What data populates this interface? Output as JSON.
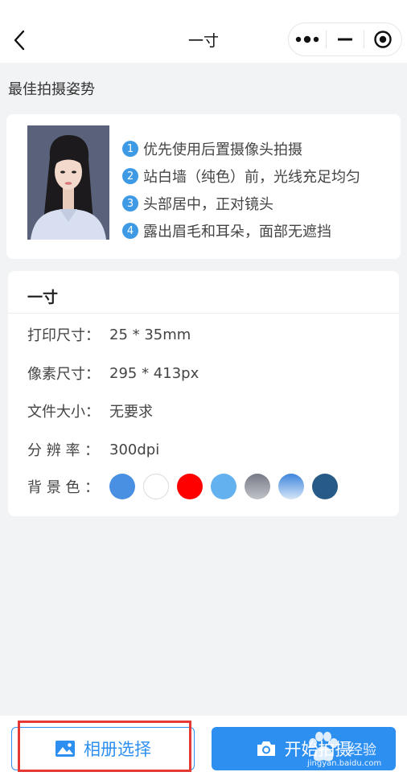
{
  "navbar": {
    "title": "一寸"
  },
  "pose_section": {
    "label": "最佳拍摄姿势",
    "tips": [
      {
        "num": "1",
        "text": "优先使用后置摄像头拍摄"
      },
      {
        "num": "2",
        "text": "站白墙（纯色）前，光线充足均匀"
      },
      {
        "num": "3",
        "text": "头部居中，正对镜头"
      },
      {
        "num": "4",
        "text": "露出眉毛和耳朵，面部无遮挡"
      }
    ]
  },
  "spec": {
    "title": "一寸",
    "rows": [
      {
        "key": "打印尺寸：",
        "value": "25 * 35mm"
      },
      {
        "key": "像素尺寸：",
        "value": "295 * 413px"
      },
      {
        "key": "文件大小：",
        "value": "无要求"
      },
      {
        "key": "分 辨 率 ：",
        "value": "300dpi"
      }
    ],
    "bg_label": "背 景 色 ：",
    "bg_colors": [
      {
        "name": "blue",
        "color": "#4a90e2"
      },
      {
        "name": "white",
        "color": "#ffffff"
      },
      {
        "name": "red",
        "color": "#ff0000"
      },
      {
        "name": "light-blue",
        "color": "#64b1f0"
      },
      {
        "name": "gray-gradient",
        "color": "#8b8d96"
      },
      {
        "name": "blue-gradient",
        "color": "#5b9ee6"
      },
      {
        "name": "dark-blue",
        "color": "#275a86"
      }
    ]
  },
  "bottom": {
    "album_label": "相册选择",
    "shoot_label": "开始拍摄"
  },
  "watermark": {
    "text": "经验",
    "url": "jingyan.baidu.com"
  },
  "colors": {
    "accent": "#2d8ff0",
    "tip_badge": "#3e9ae4",
    "highlight": "#e53935"
  }
}
